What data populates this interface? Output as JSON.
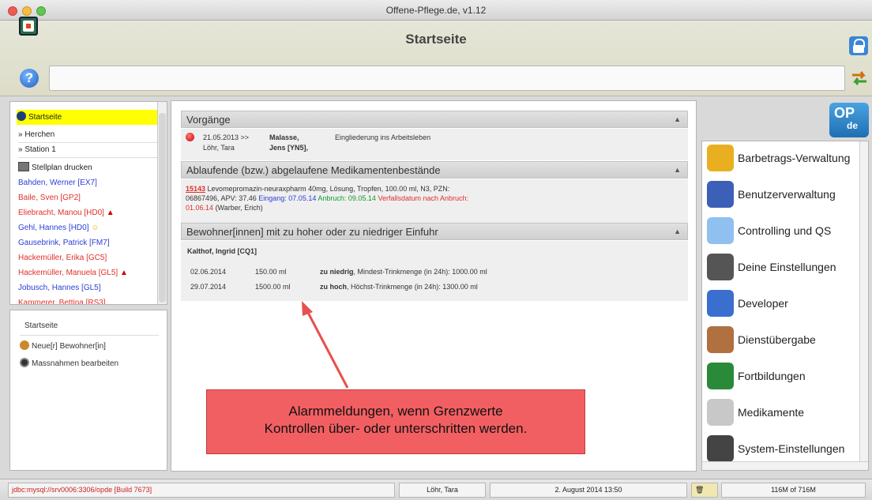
{
  "window": {
    "title": "Offene-Pflege.de, v1.12"
  },
  "header": {
    "title": "Startseite"
  },
  "sidebar": {
    "items": [
      {
        "label": "Startseite"
      },
      {
        "label": "» Herchen"
      },
      {
        "label": "» Station 1"
      },
      {
        "label": "Stellplan drucken"
      }
    ],
    "residents": [
      {
        "label": "Bahden, Werner [EX7]"
      },
      {
        "label": "Baile, Sven [GP2]"
      },
      {
        "label": "Eliebracht, Manou [HD0]"
      },
      {
        "label": "Gehl, Hannes [HD0]"
      },
      {
        "label": "Gausebrink, Patrick [FM7]"
      },
      {
        "label": "Hackemüller, Erika [GC5]"
      },
      {
        "label": "Hackemüller, Manuela [GL5]"
      },
      {
        "label": "Jobusch, Hannes [GL5]"
      },
      {
        "label": "Kammerer, Bettina [RS3]"
      }
    ],
    "bottom": {
      "title": "Startseite",
      "items": [
        {
          "label": "Neue[r] Bewohner[in]"
        },
        {
          "label": "Massnahmen bearbeiten"
        }
      ]
    }
  },
  "vorgaenge": {
    "title": "Vorgänge",
    "date": "21.05.2013 >>",
    "name1": "Malasse,",
    "name2": "Jens [YN5],",
    "author": "Löhr, Tara",
    "text": "Eingliederung ins Arbeitsleben"
  },
  "medikamente": {
    "title": "Ablaufende (bzw.) abgelaufene Medikamentenbestände",
    "id": "15143",
    "desc": "Levomepromazin-neuraxpharm 40mg, Lösung, Tropfen, 100.00 ml, N3, PZN:",
    "line2a": "06867496, APV: 37.46",
    "eingang": "Eingang: 07.05.14",
    "anbruch": "Anbruch: 09.05.14",
    "verfall": "Verfallsdatum nach Anbruch:",
    "verfall_date": "01.06.14",
    "person": "(Warber, Erich)"
  },
  "einfuhr": {
    "title": "Bewohner[innen] mit zu hoher oder zu niedriger Einfuhr",
    "resident": "Kalthof, Ingrid [CQ1]",
    "rows": [
      {
        "date": "02.06.2014",
        "amount": "150.00 ml",
        "flag": "zu niedrig",
        "text": ", Mindest-Trinkmenge (in 24h): 1000.00 ml"
      },
      {
        "date": "29.07.2014",
        "amount": "1500.00 ml",
        "flag": "zu hoch",
        "text": ", Höchst-Trinkmenge (in 24h): 1300.00 ml"
      }
    ]
  },
  "callout": {
    "line1": "Alarmmeldungen, wenn Grenzwerte",
    "line2": "Kontrollen über- oder unterschritten werden."
  },
  "logo": {
    "main": "OP",
    "sub": "de"
  },
  "modules": [
    {
      "label": "Barbetrags-Verwaltung",
      "color": "#e8b020"
    },
    {
      "label": "Benutzerverwaltung",
      "color": "#3c5fb8"
    },
    {
      "label": "Controlling und QS",
      "color": "#8fc0f0"
    },
    {
      "label": "Deine Einstellungen",
      "color": "#555555"
    },
    {
      "label": "Developer",
      "color": "#3a6fd0"
    },
    {
      "label": "Dienstübergabe",
      "color": "#b07040"
    },
    {
      "label": "Fortbildungen",
      "color": "#2a8a3a"
    },
    {
      "label": "Medikamente",
      "color": "#c8c8c8"
    },
    {
      "label": "System-Einstellungen",
      "color": "#444444"
    }
  ],
  "status": {
    "jdbc": "jdbc:mysql://srv0006:3306/opde [Build 7673]",
    "user": "Löhr, Tara",
    "datetime": "2. August 2014 13:50",
    "memory": "116M of 716M"
  }
}
